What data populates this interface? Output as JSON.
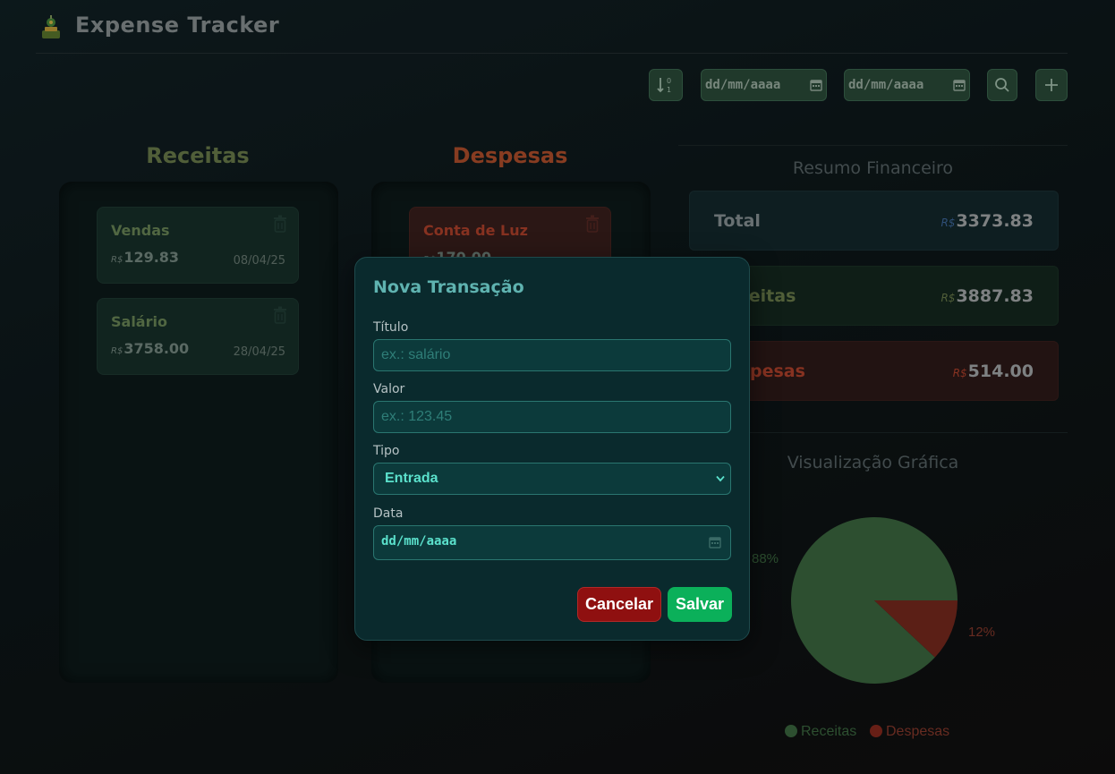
{
  "header": {
    "title": "Expense Tracker",
    "logo_icon": "money-plant-icon"
  },
  "toolbar": {
    "sort_icon": "sort-numeric-icon",
    "date_from_placeholder": "dd/mm/aaaa",
    "date_to_placeholder": "dd/mm/aaaa",
    "search_icon": "search-icon",
    "add_icon": "plus-icon"
  },
  "income": {
    "title": "Receitas",
    "items": [
      {
        "title": "Vendas",
        "currency": "R$",
        "amount": "129.83",
        "date": "08/04/25"
      },
      {
        "title": "Salário",
        "currency": "R$",
        "amount": "3758.00",
        "date": "28/04/25"
      }
    ]
  },
  "expenses": {
    "title": "Despesas",
    "items": [
      {
        "title": "Conta de Luz",
        "currency": "R$",
        "amount": "170.00",
        "date": ""
      }
    ]
  },
  "summary": {
    "title": "Resumo Financeiro",
    "total": {
      "label": "Total",
      "currency": "R$",
      "value": "3373.83"
    },
    "income": {
      "label": "Receitas",
      "currency": "R$",
      "value": "3887.83"
    },
    "expenses": {
      "label": "Despesas",
      "currency": "R$",
      "value": "514.00"
    }
  },
  "chart": {
    "title": "Visualização Gráfica",
    "colors": {
      "income": "#3c6a40",
      "expense": "#7a2a1e"
    }
  },
  "chart_data": {
    "type": "pie",
    "title": "Visualização Gráfica",
    "categories": [
      "Receitas",
      "Despesas"
    ],
    "values": [
      88,
      12
    ],
    "labels": [
      "88%",
      "12%"
    ],
    "legend": "bottom"
  },
  "modal": {
    "title": "Nova Transação",
    "title_label": "Título",
    "title_placeholder": "ex.: salário",
    "value_label": "Valor",
    "value_placeholder": "ex.: 123.45",
    "type_label": "Tipo",
    "type_selected": "Entrada",
    "date_label": "Data",
    "date_placeholder": "dd/mm/aaaa",
    "cancel_label": "Cancelar",
    "save_label": "Salvar"
  },
  "colors": {
    "income_title": "#6d7f4c",
    "expense_title": "#b4502c",
    "accent": "#5fb3b0",
    "save": "#0bb05a",
    "cancel": "#8f1010"
  }
}
